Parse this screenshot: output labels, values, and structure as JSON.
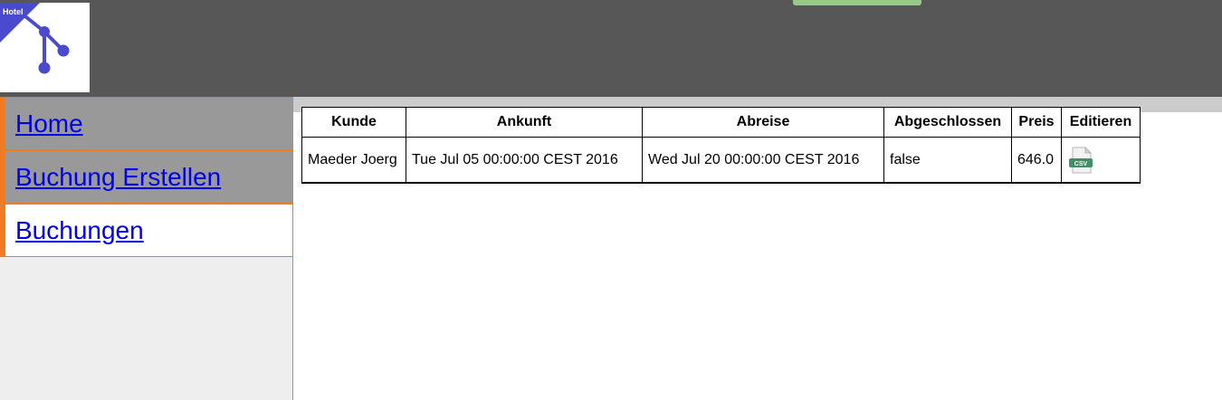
{
  "logo": {
    "text": "Hotel"
  },
  "nav": {
    "items": [
      {
        "label": "Home",
        "active": false
      },
      {
        "label": "Buchung Erstellen",
        "active": false
      },
      {
        "label": "Buchungen",
        "active": true
      }
    ]
  },
  "table": {
    "headers": [
      "Kunde",
      "Ankunft",
      "Abreise",
      "Abgeschlossen",
      "Preis",
      "Editieren"
    ],
    "rows": [
      {
        "kunde": "Maeder Joerg",
        "ankunft": "Tue Jul 05 00:00:00 CEST 2016",
        "abreise": "Wed Jul 20 00:00:00 CEST 2016",
        "abgeschlossen": "false",
        "preis": "646.0",
        "edit_icon": "csv-file-icon",
        "edit_icon_text": "CSV"
      }
    ]
  },
  "colors": {
    "header_bg": "#575757",
    "logo_accent": "#4a4acf",
    "nav_border": "#f07b22",
    "nav_bg": "#999999",
    "nav_active_bg": "#ffffff",
    "link": "#0000ee",
    "green_tab": "#98c98a"
  }
}
